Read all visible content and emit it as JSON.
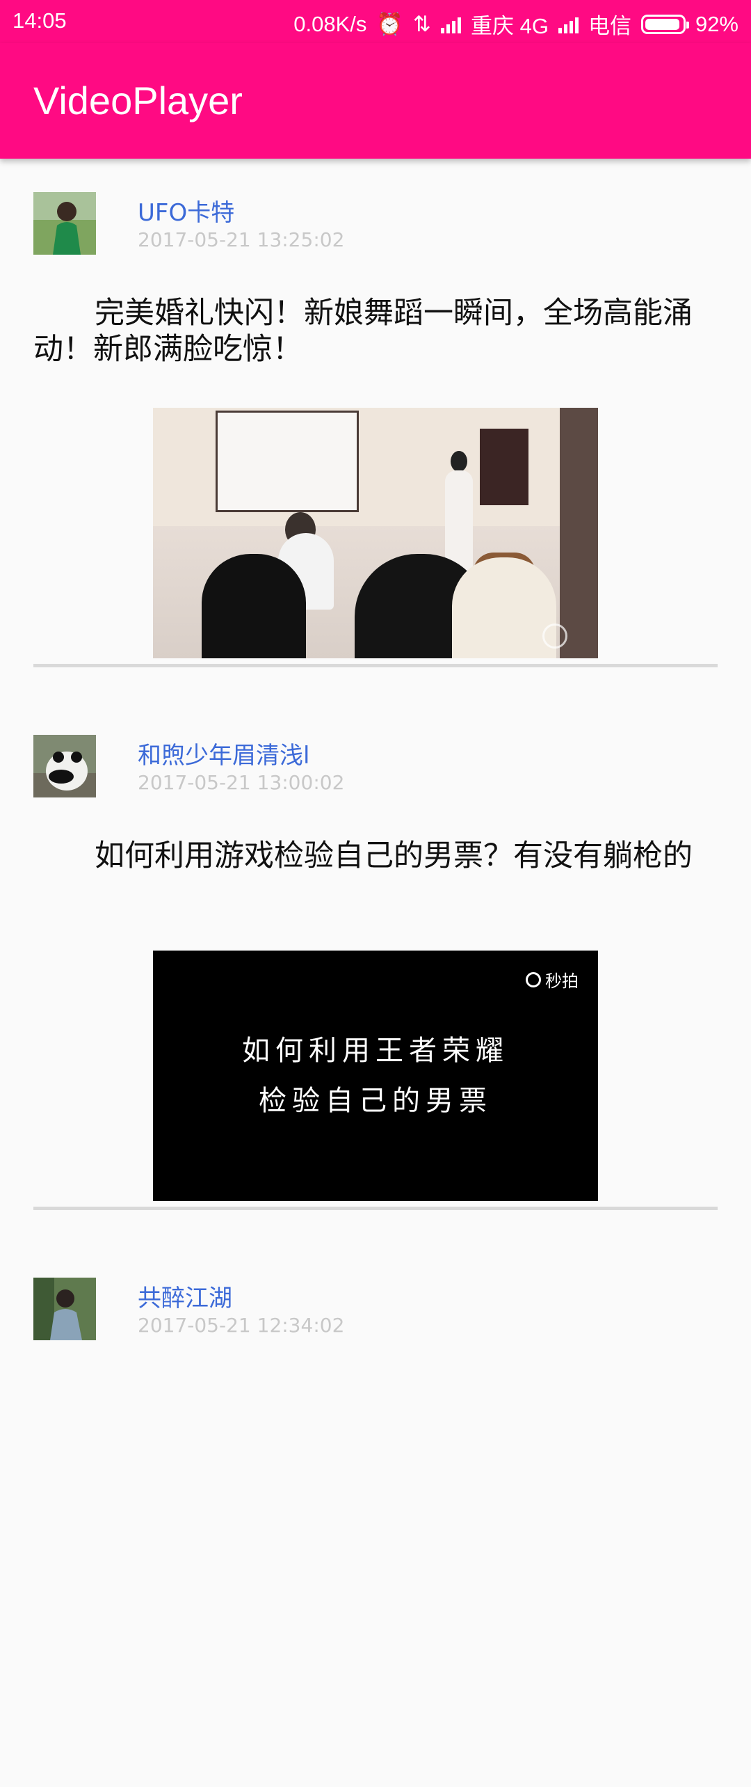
{
  "status_bar": {
    "time": "14:05",
    "speed": "0.08K/s",
    "carrier1": "重庆 4G",
    "carrier2": "电信",
    "battery": "92%"
  },
  "app_bar": {
    "title": "VideoPlayer"
  },
  "posts": [
    {
      "user": "UFO卡特",
      "time": "2017-05-21 13:25:02",
      "title": "完美婚礼快闪！新娘舞蹈一瞬间，全场高能涌动！新郎满脸吃惊！"
    },
    {
      "user": "和煦少年眉清浅l",
      "time": "2017-05-21 13:00:02",
      "title": "如何利用游戏检验自己的男票？有没有躺枪的",
      "video_watermark": "秒拍",
      "video_text_line1": "如何利用王者荣耀",
      "video_text_line2": "检验自己的男票"
    },
    {
      "user": "共醉江湖",
      "time": "2017-05-21 12:34:02"
    }
  ]
}
